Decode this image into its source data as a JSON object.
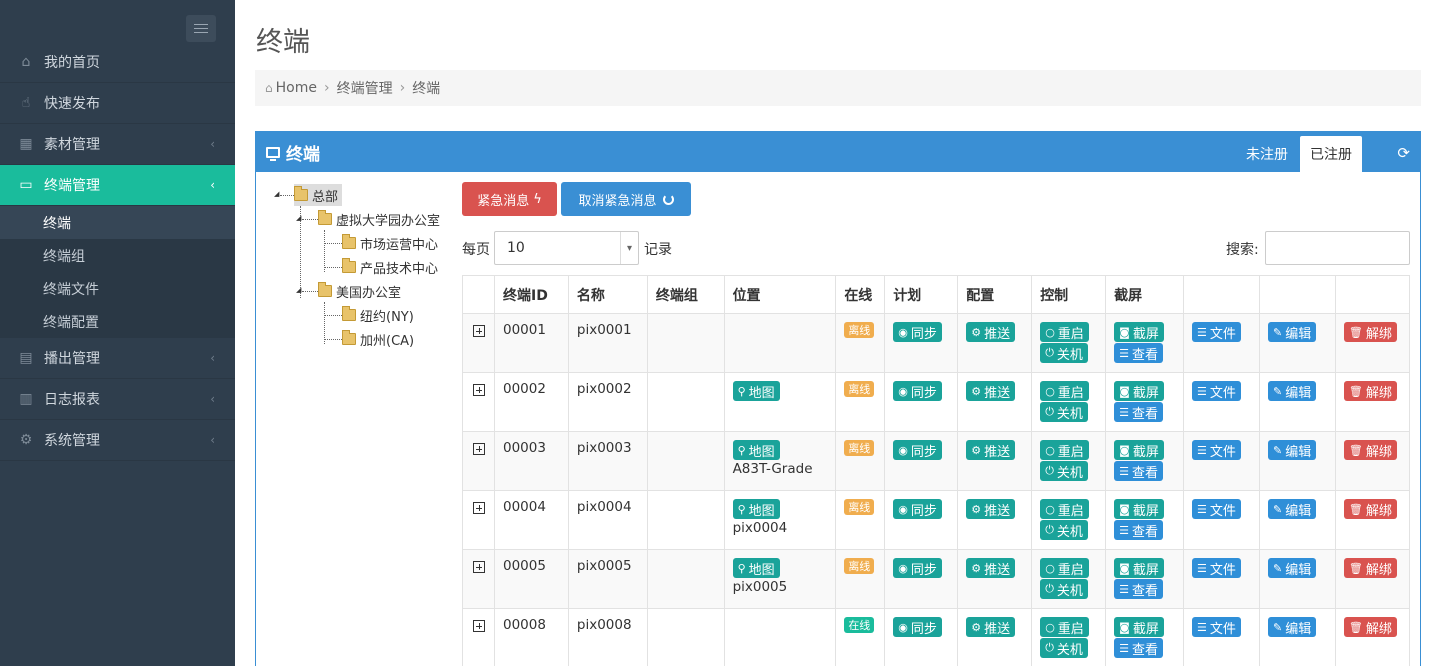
{
  "sidebar": {
    "items": [
      {
        "label": "我的首页",
        "icon": "home-icon"
      },
      {
        "label": "快速发布",
        "icon": "hand-pointer-icon"
      },
      {
        "label": "素材管理",
        "icon": "grid-icon"
      },
      {
        "label": "终端管理",
        "icon": "monitor-icon"
      },
      {
        "label": "播出管理",
        "icon": "calendar-icon"
      },
      {
        "label": "日志报表",
        "icon": "bar-chart-icon"
      },
      {
        "label": "系统管理",
        "icon": "gears-icon"
      }
    ],
    "sub_items": [
      "终端",
      "终端组",
      "终端文件",
      "终端配置"
    ]
  },
  "page": {
    "title": "终端",
    "breadcrumb": [
      "Home",
      "终端管理",
      "终端"
    ]
  },
  "panel": {
    "title": "终端",
    "tab_unregistered": "未注册",
    "tab_registered": "已注册"
  },
  "tree": {
    "root": "总部",
    "nodes": [
      "虚拟大学园办公室",
      "市场运营中心",
      "产品技术中心",
      "美国办公室",
      "纽约(NY)",
      "加州(CA)"
    ]
  },
  "toolbar": {
    "urgent": "紧急消息",
    "cancel_urgent": "取消紧急消息",
    "per_page": "每页",
    "page_size": "10",
    "records": "记录",
    "search_label": "搜索:"
  },
  "table": {
    "headers": [
      "终端ID",
      "名称",
      "终端组",
      "位置",
      "在线",
      "计划",
      "配置",
      "控制",
      "截屏"
    ],
    "rows": [
      {
        "id": "00001",
        "name": "pix0001",
        "map": "",
        "loc": "",
        "status": "离线"
      },
      {
        "id": "00002",
        "name": "pix0002",
        "map": "地图",
        "loc": "",
        "status": "离线"
      },
      {
        "id": "00003",
        "name": "pix0003",
        "map": "地图",
        "loc": "A83T-Grade",
        "status": "离线"
      },
      {
        "id": "00004",
        "name": "pix0004",
        "map": "地图",
        "loc": "pix0004",
        "status": "离线"
      },
      {
        "id": "00005",
        "name": "pix0005",
        "map": "地图",
        "loc": "pix0005",
        "status": "离线"
      },
      {
        "id": "00008",
        "name": "pix0008",
        "map": "",
        "loc": "",
        "status": "在线"
      }
    ],
    "actions": {
      "sync": "同步",
      "push": "推送",
      "restart": "重启",
      "shutdown": "关机",
      "screenshot": "截屏",
      "view": "查看",
      "files": "文件",
      "edit": "编辑",
      "unbind": "解绑"
    }
  },
  "colors": {
    "sidebar_bg": "#2f3e4d",
    "active": "#1abc9c",
    "primary": "#3a8fd4",
    "danger": "#d9534f",
    "offline": "#f0ad4e"
  }
}
